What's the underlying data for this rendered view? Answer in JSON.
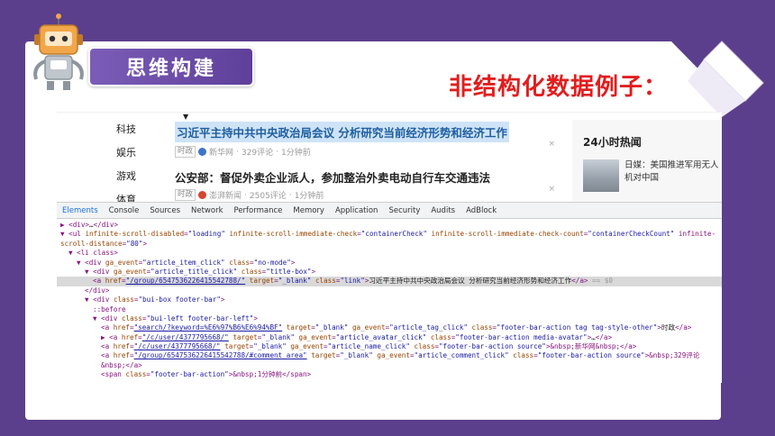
{
  "slide": {
    "banner_title": "思维构建",
    "heading": "非结构化数据例子：",
    "colors": {
      "background": "#5b3f8c",
      "banner": "#6a4aa8",
      "heading": "#e11e1e"
    }
  },
  "news_page": {
    "categories": [
      "科技",
      "娱乐",
      "游戏",
      "体育"
    ],
    "items": [
      {
        "title": "习近平主持中共中央政治局会议 分析研究当前经济形势和经济工作",
        "tag": "时政",
        "source": "新华网",
        "comments": "329评论",
        "time": "1分钟前",
        "selected": true
      },
      {
        "title": "公安部：督促外卖企业派人，参加整治外卖电动自行车交通违法",
        "tag": "时政",
        "source": "澎湃新闻",
        "comments": "2505评论",
        "time": "1分钟前",
        "selected": false
      }
    ],
    "close_mark": "×",
    "hot": {
      "title": "24小时热闻",
      "item_text": "日媒：美国推进军用无人机对中国"
    }
  },
  "devtools": {
    "tabs": [
      "Elements",
      "Console",
      "Sources",
      "Network",
      "Performance",
      "Memory",
      "Application",
      "Security",
      "Audits",
      "AdBlock"
    ],
    "active_tab": "Elements",
    "lines": [
      {
        "text": "▶ <div>…</div>",
        "indent": 0
      },
      {
        "text": "▼ <ul infinite-scroll-disabled=\"loading\" infinite-scroll-immediate-check=\"containerCheck\" infinite-scroll-immediate-check-count=\"containerCheckCount\" infinite-",
        "indent": 0
      },
      {
        "text": "scroll-distance=\"80\">",
        "indent": 0
      },
      {
        "text": "▼ <li class>",
        "indent": 1
      },
      {
        "text": "▼ <div ga_event=\"article_item_click\" class=\"no-mode\">",
        "indent": 2
      },
      {
        "text": "▼ <div ga_event=\"article_title_click\" class=\"title-box\">",
        "indent": 3
      },
      {
        "text": "<a href=\"/group/6547536226415542788/\" target=\"_blank\" class=\"link\">习近平主持中共中央政治局会议 分析研究当前经济形势和经济工作</a> == $0",
        "indent": 4,
        "highlight": true
      },
      {
        "text": "</div>",
        "indent": 3
      },
      {
        "text": "▼ <div class=\"bui-box footer-bar\">",
        "indent": 3
      },
      {
        "text": "::before",
        "indent": 4
      },
      {
        "text": "▼ <div class=\"bui-left footer-bar-left\">",
        "indent": 4
      },
      {
        "text": "<a href=\"search/?keyword=%E6%97%B6%E6%94%BF\" target=\"_blank\" ga_event=\"article_tag_click\" class=\"footer-bar-action tag tag-style-other\">时政</a>",
        "indent": 5
      },
      {
        "text": "▶ <a href=\"/c/user/4377795668/\" target=\"_blank\" ga_event=\"article_avatar_click\" class=\"footer-bar-action media-avatar\">…</a>",
        "indent": 5
      },
      {
        "text": "<a href=\"/c/user/4377795668/\" target=\"_blank\" ga_event=\"article_name_click\" class=\"footer-bar-action source\">&nbsp;新华网&nbsp;</a>",
        "indent": 5
      },
      {
        "text": "<a href=\"/group/6547536226415542788/#comment_area\" target=\"_blank\" ga_event=\"article_comment_click\" class=\"footer-bar-action source\">&nbsp;329评论",
        "indent": 5
      },
      {
        "text": "&nbsp;</a>",
        "indent": 5
      },
      {
        "text": "<span class=\"footer-bar-action\">&nbsp;1分钟前</span>",
        "indent": 5
      }
    ]
  }
}
